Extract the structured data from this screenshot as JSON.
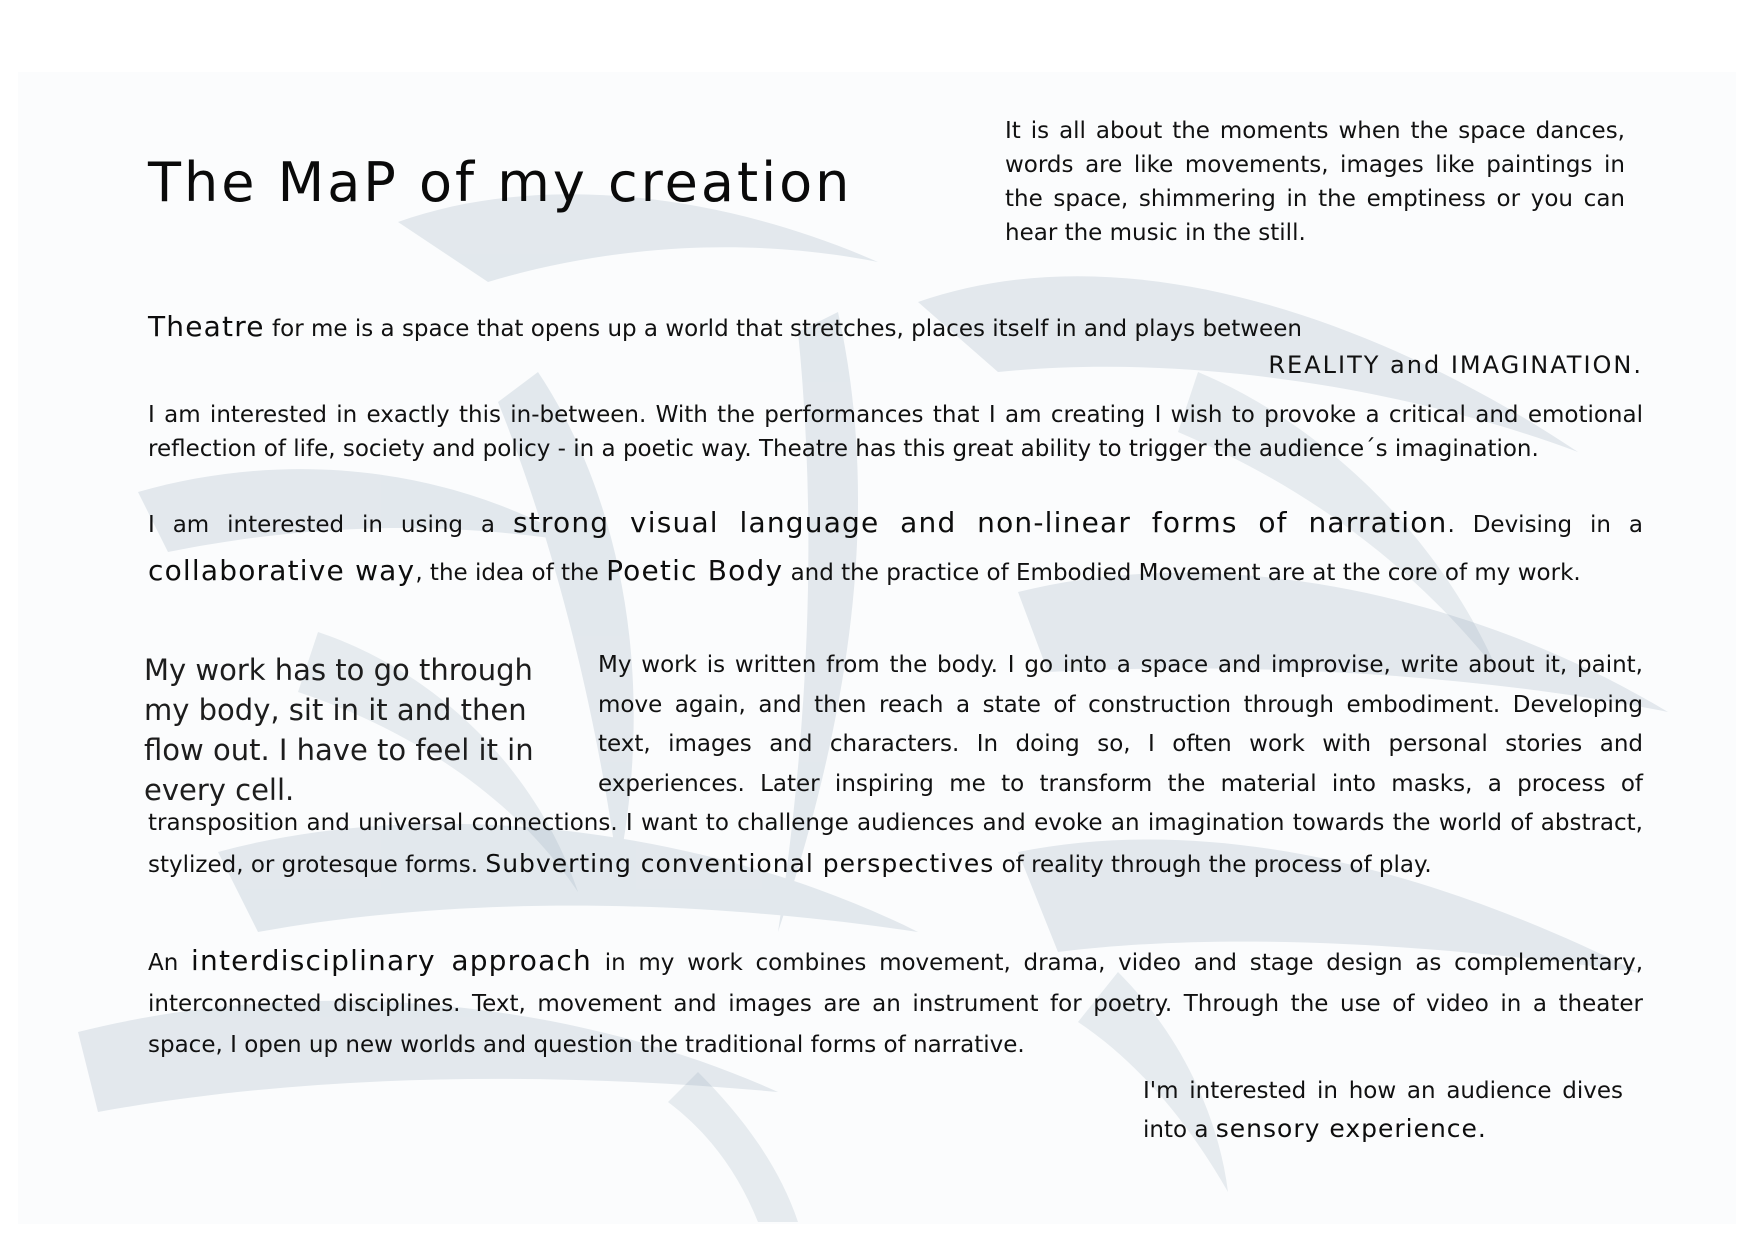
{
  "title": "The MaP of my creation",
  "intro": "It is all about the moments when the space dances, words are like movements, images like paintings in the space, shimmering in the emptiness or you can hear the music in the still.",
  "theatre": {
    "keyword": "Theatre",
    "text": " for me is a space that opens up a world that stretches, places itself in and plays between",
    "emphasis": "REALITY and IMAGINATION."
  },
  "inbetween": "I am interested in exactly this in-between. With the performances that I am creating I wish to provoke a critical and emotional reflection of life, society and policy  - in a poetic way.  Theatre has this great ability to trigger the audience´s imagination.",
  "visual": {
    "t1": "I am interested in using a ",
    "e1": "strong visual language and non-linear forms of narration",
    "t2": ". Devising in a ",
    "e2": "collaborative way",
    "t3": ", the idea of the ",
    "e3": "Poetic Body",
    "t4": " and the practice of Embodied Movement are at the core of my work."
  },
  "quote": "My work has to go through my body, sit in it and then flow out. I have to feel it in every cell.",
  "body": {
    "text": "My work is written from the body. I go into a space and improvise, write about it, paint, move again, and then reach a state of construction through embodiment. Developing text, images and characters.  In doing so, I often work with personal stories and experiences. Later inspiring me to transform the material into masks, a process of transposition and universal connections. I want to challenge audiences and evoke an imagination towards the world of abstract, stylized, or grotesque forms.",
    "emphasis": "Subverting conventional perspectives",
    "tail": " of reality through the process of play."
  },
  "interdisciplinary": {
    "t1": "An ",
    "e1": "interdisciplinary approach",
    "t2": " in my work combines movement, drama, video and stage design as complementary, interconnected disciplines.  Text, movement and images are an instrument for poetry. Through the use of video in a theater space, I open up new worlds and question the traditional forms of narrative."
  },
  "sensory": {
    "text": "I'm interested in how an audience dives into a ",
    "emphasis": "sensory experience."
  },
  "colors": {
    "background_wash": "#8fa6b8",
    "text": "#111111"
  }
}
